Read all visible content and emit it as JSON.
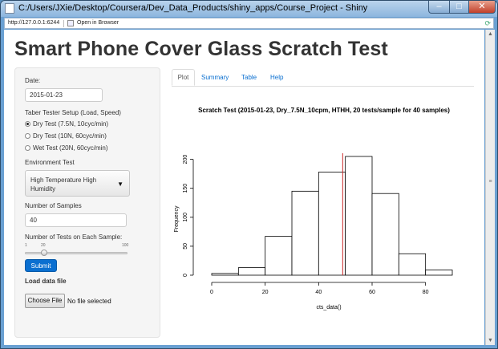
{
  "window": {
    "title": "C:/Users/JXie/Desktop/Coursera/Dev_Data_Products/shiny_apps/Course_Project - Shiny"
  },
  "address_bar": {
    "url": "http://127.0.0.1:6244",
    "open_in_browser": "Open in Browser"
  },
  "page": {
    "title": "Smart Phone Cover Glass Scratch Test"
  },
  "sidebar": {
    "date_label": "Date:",
    "date_value": "2015-01-23",
    "taber_label": "Taber Tester Setup (Load, Speed)",
    "radio_options": [
      "Dry Test (7.5N, 10cyc/min)",
      "Dry Test (10N, 60cyc/min)",
      "Wet Test (20N, 60cyc/min)"
    ],
    "radio_selected": 0,
    "env_label": "Environment Test",
    "env_value": "High Temperature High Humidity",
    "samples_label": "Number of Samples",
    "samples_value": "40",
    "tests_label": "Number of Tests on Each Sample:",
    "slider": {
      "min": "1",
      "value": "20",
      "max": "100",
      "fraction": 0.19
    },
    "submit_label": "Submit",
    "load_label": "Load data file",
    "choose_file_label": "Choose File",
    "file_status": "No file selected"
  },
  "tabs": [
    "Plot",
    "Summary",
    "Table",
    "Help"
  ],
  "active_tab": "Plot",
  "colors": {
    "accent": "#0a6fd0",
    "mean_line": "#cc2a2a"
  },
  "chart_data": {
    "type": "bar",
    "title": "Scratch Test (2015-01-23, Dry_7.5N_10cpm, HTHH, 20 tests/sample for 40 samples)",
    "xlabel": "cts_data()",
    "ylabel": "Frequency",
    "bin_edges": [
      0,
      10,
      20,
      30,
      40,
      50,
      60,
      70,
      80,
      90
    ],
    "values": [
      3,
      13,
      67,
      145,
      178,
      205,
      141,
      37,
      9
    ],
    "xlim": [
      0,
      90
    ],
    "ylim": [
      0,
      205
    ],
    "xticks": [
      "0",
      "20",
      "40",
      "60",
      "80"
    ],
    "xtick_values": [
      0,
      20,
      40,
      60,
      80
    ],
    "yticks": [
      "0",
      "50",
      "100",
      "150",
      "200"
    ],
    "ytick_values": [
      0,
      50,
      100,
      150,
      200
    ],
    "vline": 49
  }
}
